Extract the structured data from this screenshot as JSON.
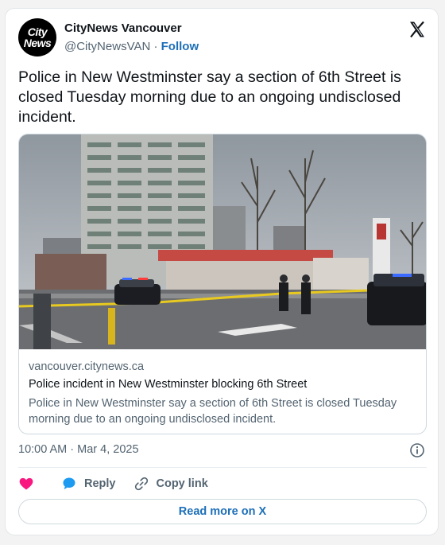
{
  "author": {
    "avatar_line1": "City",
    "avatar_line2": "News",
    "name": "CityNews Vancouver",
    "handle": "@CityNewsVAN",
    "separator": " · ",
    "follow_label": "Follow"
  },
  "tweet": {
    "text": "Police in New Westminster say a section of 6th Street is closed Tuesday morning due to an ongoing undisclosed incident."
  },
  "link_card": {
    "domain": "vancouver.citynews.ca",
    "title": "Police incident in New Westminster blocking 6th Street",
    "description": "Police in New Westminster say a section of 6th Street is closed Tuesday morning due to an ongoing undisclosed incident."
  },
  "meta": {
    "timestamp": "10:00 AM · Mar 4, 2025"
  },
  "actions": {
    "like_icon": "heart-icon",
    "reply_label": "Reply",
    "copy_link_label": "Copy link"
  },
  "footer": {
    "read_more_label": "Read more on X"
  },
  "colors": {
    "link_blue": "#1d6fb8",
    "heart_pink": "#f91880",
    "reply_blue": "#1d9bf0",
    "muted_text": "#536471"
  }
}
